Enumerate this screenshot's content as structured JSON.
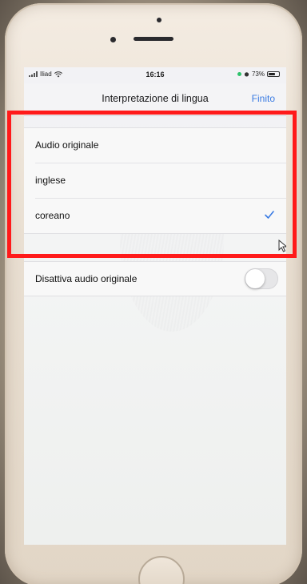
{
  "status_bar": {
    "carrier": "Iliad",
    "time": "16:16",
    "battery": "73%",
    "battery_level": 0.73
  },
  "nav": {
    "title": "Interpretazione di lingua",
    "done_label": "Finito"
  },
  "language_options": [
    {
      "label": "Audio originale",
      "selected": false
    },
    {
      "label": "inglese",
      "selected": false
    },
    {
      "label": "coreano",
      "selected": true
    }
  ],
  "toggle": {
    "label": "Disattiva audio originale",
    "enabled": false
  },
  "colors": {
    "accent": "#3a7be3",
    "highlight": "#ff1a1a",
    "location": "#2ec26b"
  },
  "icons": [
    "signal-icon",
    "wifi-icon",
    "location-icon",
    "alarm-icon",
    "battery-icon",
    "checkmark-icon",
    "cursor-icon"
  ]
}
